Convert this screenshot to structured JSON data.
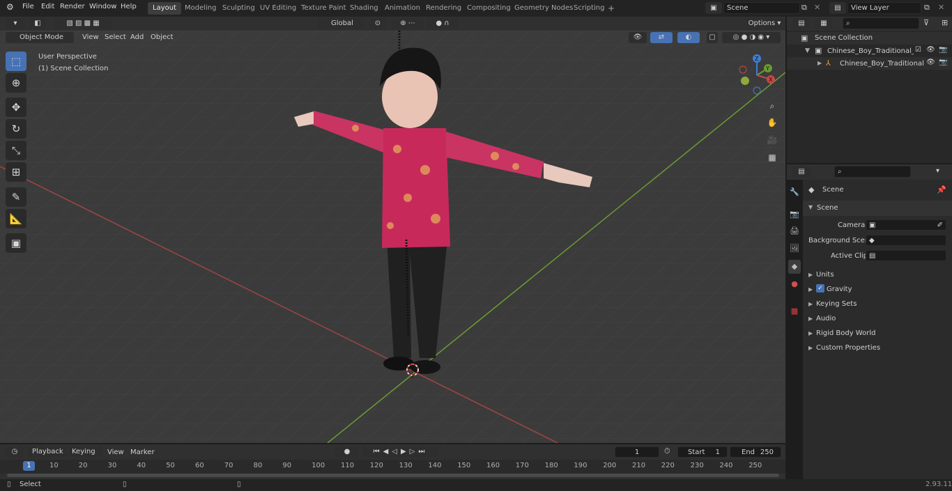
{
  "topbar": {
    "menus": [
      "File",
      "Edit",
      "Render",
      "Window",
      "Help"
    ],
    "workspaces": [
      "Layout",
      "Modeling",
      "Sculpting",
      "UV Editing",
      "Texture Paint",
      "Shading",
      "Animation",
      "Rendering",
      "Compositing",
      "Geometry Nodes",
      "Scripting"
    ],
    "active_workspace": "Layout",
    "add_workspace": "+",
    "scene_name": "Scene",
    "view_layer": "View Layer"
  },
  "viewport_header": {
    "mode": "Object Mode",
    "menus": [
      "View",
      "Select",
      "Add",
      "Object"
    ],
    "orientation": "Global",
    "options_label": "Options"
  },
  "viewport": {
    "perspective_label": "User Perspective",
    "collection_label": "(1) Scene Collection",
    "gizmo_axes": [
      "Z",
      "Y",
      "X"
    ]
  },
  "outliner": {
    "root": "Scene Collection",
    "items": [
      {
        "label": "Chinese_Boy_Traditional_Tan"
      },
      {
        "label": "Chinese_Boy_Traditional"
      }
    ]
  },
  "properties": {
    "header_title": "Scene",
    "panel_title": "Scene",
    "fields": [
      {
        "label": "Camera"
      },
      {
        "label": "Background Scene"
      },
      {
        "label": "Active Clip"
      }
    ],
    "sections": [
      "Units",
      "Gravity",
      "Keying Sets",
      "Audio",
      "Rigid Body World",
      "Custom Properties"
    ]
  },
  "timeline": {
    "menus": [
      "Playback",
      "Keying",
      "View",
      "Marker"
    ],
    "current_frame": "1",
    "start_label": "Start",
    "start_value": "1",
    "end_label": "End",
    "end_value": "250",
    "ruler_current": "1",
    "ruler_ticks": [
      "10",
      "20",
      "30",
      "40",
      "50",
      "60",
      "70",
      "80",
      "90",
      "100",
      "110",
      "120",
      "130",
      "140",
      "150",
      "160",
      "170",
      "180",
      "190",
      "200",
      "210",
      "220",
      "230",
      "240",
      "250"
    ]
  },
  "statusbar": {
    "action": "Select",
    "version": "2.93.11"
  },
  "colors": {
    "accent": "#4772b3",
    "x_axis": "#b34c4c",
    "y_axis": "#6a9a30",
    "z_axis": "#3e7ed6"
  }
}
